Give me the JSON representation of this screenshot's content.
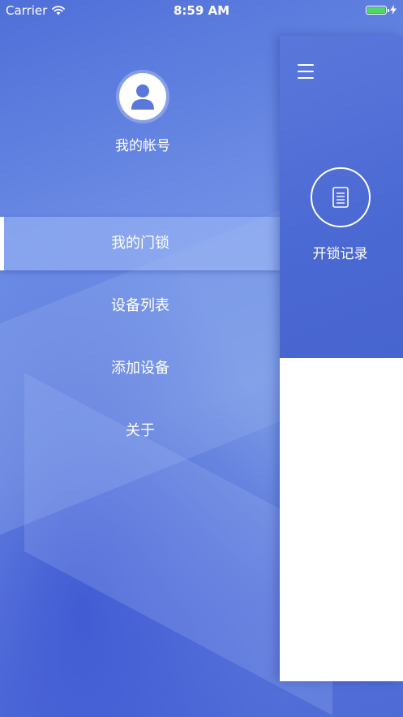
{
  "status_bar": {
    "carrier": "Carrier",
    "time": "8:59 AM",
    "battery_level": 1.0,
    "battery_color": "#4cd964"
  },
  "drawer": {
    "account_label": "我的帐号",
    "avatar_icon": "user-avatar-icon",
    "menu": [
      {
        "label": "我的门锁",
        "active": true
      },
      {
        "label": "设备列表",
        "active": false
      },
      {
        "label": "添加设备",
        "active": false
      },
      {
        "label": "关于",
        "active": false
      }
    ]
  },
  "main_panel": {
    "menu_icon": "hamburger-menu-icon",
    "action": {
      "label": "开锁记录",
      "icon": "document-icon"
    },
    "header_color": "#4b69d3"
  }
}
